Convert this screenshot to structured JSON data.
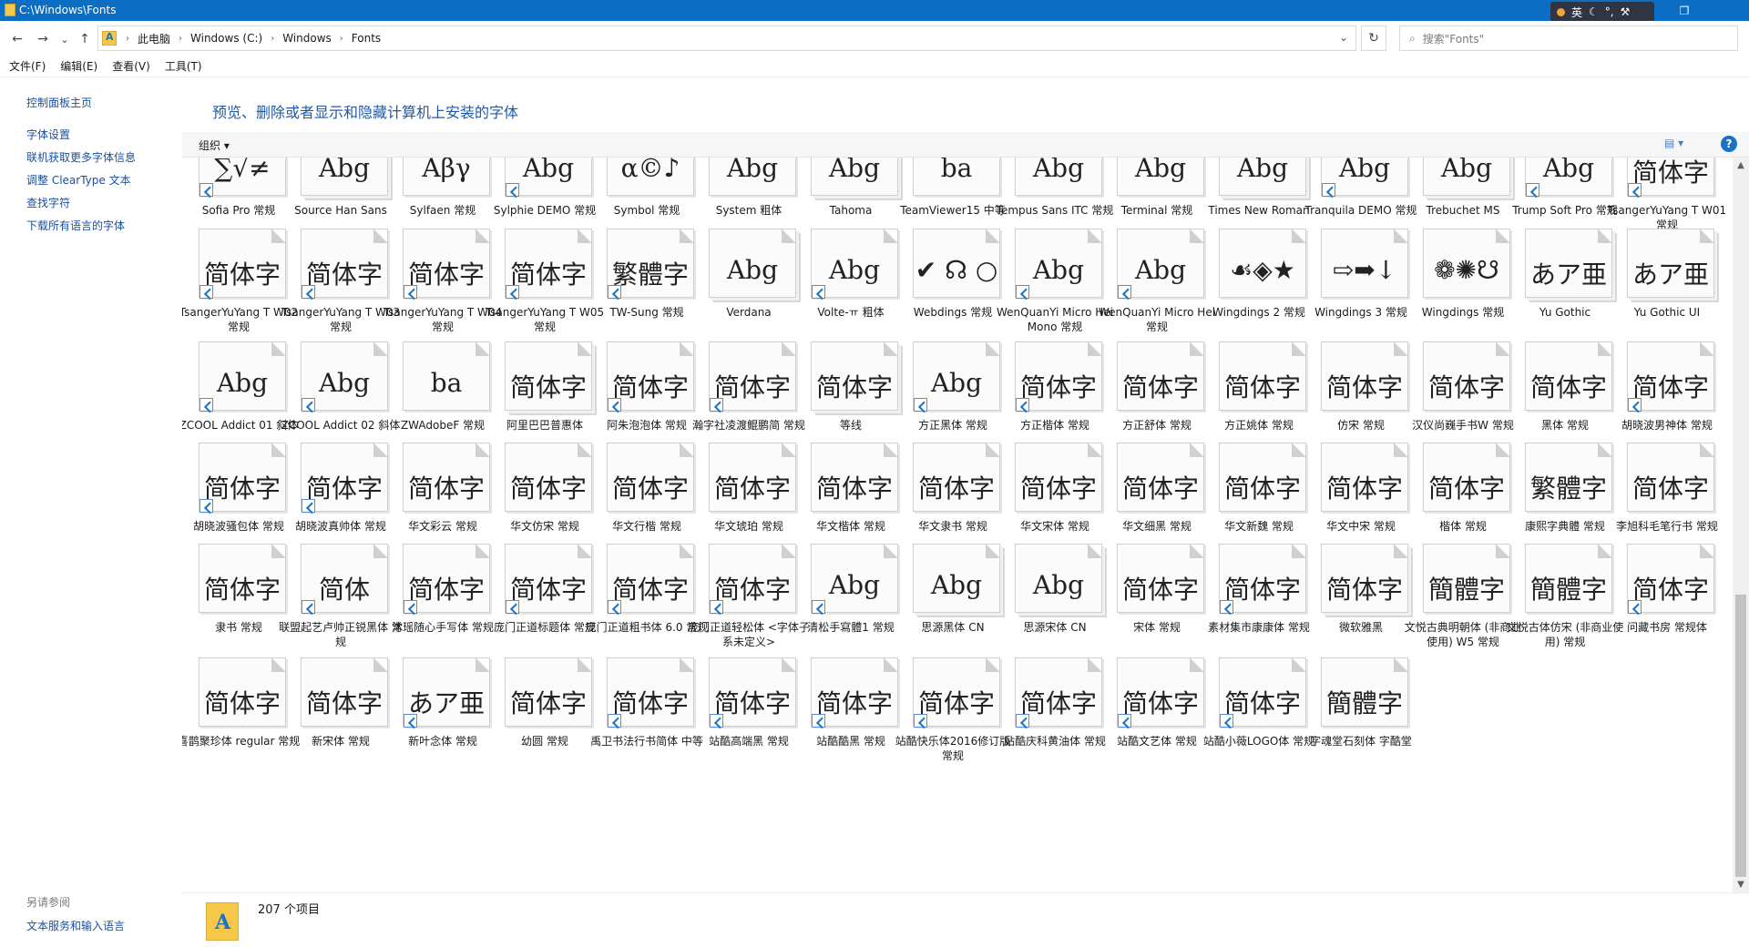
{
  "window": {
    "title": "C:\\Windows\\Fonts",
    "min": "—",
    "max": "❐",
    "close": "✕"
  },
  "ime": {
    "lang": "英",
    "moon": "☾",
    "punct": "°,",
    "tool": "⚒",
    "shirt": "▣"
  },
  "nav": {
    "back": "←",
    "forward": "→",
    "recent": "⌄",
    "up": "↑",
    "refresh": "↻",
    "dropdown": "⌄"
  },
  "breadcrumb": [
    "此电脑",
    "Windows (C:)",
    "Windows",
    "Fonts"
  ],
  "search": {
    "placeholder": "搜索\"Fonts\"",
    "icon": "⌕"
  },
  "menu": [
    "文件(F)",
    "编辑(E)",
    "查看(V)",
    "工具(T)"
  ],
  "left_links": [
    "控制面板主页",
    "字体设置",
    "联机获取更多字体信息",
    "调整 ClearType 文本",
    "查找字符",
    "下载所有语言的字体"
  ],
  "see_also": {
    "title": "另请参阅",
    "link": "文本服务和输入语言"
  },
  "header": {
    "description": "预览、删除或者显示和隐藏计算机上安装的字体"
  },
  "toolbar": {
    "organize": "组织 ▾",
    "view": "▤ ▾",
    "help": "?"
  },
  "status": {
    "count": "207 个项目"
  },
  "scroll": {
    "up": "▲",
    "down": "▼"
  },
  "rows": [
    [
      {
        "s": "∑√≠",
        "l": "Sofia Pro 常规",
        "sc": true,
        "st": false
      },
      {
        "s": "Abg",
        "l": "Source Han Sans",
        "sc": false,
        "st": true
      },
      {
        "s": "Αβγ",
        "l": "Sylfaen 常规",
        "sc": false,
        "st": false
      },
      {
        "s": "Abg",
        "l": "Sylphie DEMO 常规",
        "sc": true,
        "st": false
      },
      {
        "s": "α©♪",
        "l": "Symbol 常规",
        "sc": false,
        "st": false
      },
      {
        "s": "Abg",
        "l": "System 粗体",
        "sc": false,
        "st": false
      },
      {
        "s": "Abg",
        "l": "Tahoma",
        "sc": false,
        "st": true
      },
      {
        "s": "ba",
        "l": "TeamViewer15 中等",
        "sc": false,
        "st": false
      },
      {
        "s": "Abg",
        "l": "Tempus Sans ITC 常规",
        "sc": false,
        "st": false
      },
      {
        "s": "Abg",
        "l": "Terminal 常规",
        "sc": false,
        "st": false
      },
      {
        "s": "Abg",
        "l": "Times New Roman",
        "sc": false,
        "st": true
      },
      {
        "s": "Abg",
        "l": "Tranquila DEMO 常规",
        "sc": true,
        "st": false
      },
      {
        "s": "Abg",
        "l": "Trebuchet MS",
        "sc": false,
        "st": true
      },
      {
        "s": "Abg",
        "l": "Trump Soft Pro 常规",
        "sc": true,
        "st": false
      },
      {
        "s": "简体字",
        "l": "TsangerYuYang T W01 常规",
        "sc": true,
        "st": false
      }
    ],
    [
      {
        "s": "简体字",
        "l": "TsangerYuYang T W02 常规",
        "sc": true,
        "st": false
      },
      {
        "s": "简体字",
        "l": "TsangerYuYang T W03 常规",
        "sc": true,
        "st": false
      },
      {
        "s": "简体字",
        "l": "TsangerYuYang T W04 常规",
        "sc": true,
        "st": false
      },
      {
        "s": "简体字",
        "l": "TsangerYuYang T W05 常规",
        "sc": true,
        "st": false
      },
      {
        "s": "繁體字",
        "l": "TW-Sung 常规",
        "sc": true,
        "st": false
      },
      {
        "s": "Abg",
        "l": "Verdana",
        "sc": false,
        "st": true
      },
      {
        "s": "Abg",
        "l": "Volte-ㅠ 粗体",
        "sc": true,
        "st": false
      },
      {
        "s": "✔ ☊ ○",
        "l": "Webdings 常规",
        "sc": false,
        "st": false
      },
      {
        "s": "Abg",
        "l": "WenQuanYi Micro Hei Mono 常规",
        "sc": true,
        "st": false
      },
      {
        "s": "Abg",
        "l": "WenQuanYi Micro Hei 常规",
        "sc": true,
        "st": false
      },
      {
        "s": "☙◈★",
        "l": "Wingdings 2 常规",
        "sc": false,
        "st": false
      },
      {
        "s": "⇨➡↓",
        "l": "Wingdings 3 常规",
        "sc": false,
        "st": false
      },
      {
        "s": "❁✺☋",
        "l": "Wingdings 常规",
        "sc": false,
        "st": false
      },
      {
        "s": "あア亜",
        "l": "Yu Gothic",
        "sc": false,
        "st": true
      },
      {
        "s": "あア亜",
        "l": "Yu Gothic UI",
        "sc": false,
        "st": true
      }
    ],
    [
      {
        "s": "Abg",
        "l": "ZCOOL Addict 01 斜体",
        "sc": true,
        "st": false
      },
      {
        "s": "Abg",
        "l": "ZCOOL Addict 02 斜体",
        "sc": true,
        "st": false
      },
      {
        "s": "ba",
        "l": "ZWAdobeF 常规",
        "sc": false,
        "st": false
      },
      {
        "s": "简体字",
        "l": "阿里巴巴普惠体",
        "sc": false,
        "st": true
      },
      {
        "s": "简体字",
        "l": "阿朱泡泡体 常规",
        "sc": true,
        "st": false
      },
      {
        "s": "简体字",
        "l": "瀚字社凌渡鲲鹏简 常规",
        "sc": true,
        "st": false
      },
      {
        "s": "简体字",
        "l": "等线",
        "sc": false,
        "st": true
      },
      {
        "s": "Abg",
        "l": "方正黑体 常规",
        "sc": true,
        "st": false
      },
      {
        "s": "简体字",
        "l": "方正楷体 常规",
        "sc": true,
        "st": false
      },
      {
        "s": "简体字",
        "l": "方正舒体 常规",
        "sc": false,
        "st": false
      },
      {
        "s": "简体字",
        "l": "方正姚体 常规",
        "sc": false,
        "st": false
      },
      {
        "s": "简体字",
        "l": "仿宋 常规",
        "sc": false,
        "st": false
      },
      {
        "s": "简体字",
        "l": "汉仪尚巍手书W 常规",
        "sc": false,
        "st": false
      },
      {
        "s": "简体字",
        "l": "黑体 常规",
        "sc": false,
        "st": false
      },
      {
        "s": "简体字",
        "l": "胡晓波男神体 常规",
        "sc": true,
        "st": false
      }
    ],
    [
      {
        "s": "简体字",
        "l": "胡晓波骚包体 常规",
        "sc": true,
        "st": false
      },
      {
        "s": "简体字",
        "l": "胡晓波真帅体 常规",
        "sc": true,
        "st": false
      },
      {
        "s": "简体字",
        "l": "华文彩云 常规",
        "sc": false,
        "st": false
      },
      {
        "s": "简体字",
        "l": "华文仿宋 常规",
        "sc": false,
        "st": false
      },
      {
        "s": "简体字",
        "l": "华文行楷 常规",
        "sc": false,
        "st": false
      },
      {
        "s": "简体字",
        "l": "华文琥珀 常规",
        "sc": false,
        "st": false
      },
      {
        "s": "简体字",
        "l": "华文楷体 常规",
        "sc": false,
        "st": false
      },
      {
        "s": "简体字",
        "l": "华文隶书 常规",
        "sc": false,
        "st": false
      },
      {
        "s": "简体字",
        "l": "华文宋体 常规",
        "sc": false,
        "st": false
      },
      {
        "s": "简体字",
        "l": "华文细黑 常规",
        "sc": false,
        "st": false
      },
      {
        "s": "简体字",
        "l": "华文新魏 常规",
        "sc": false,
        "st": false
      },
      {
        "s": "简体字",
        "l": "华文中宋 常规",
        "sc": false,
        "st": false
      },
      {
        "s": "简体字",
        "l": "楷体 常规",
        "sc": false,
        "st": false
      },
      {
        "s": "繁體字",
        "l": "康熙字典體 常规",
        "sc": false,
        "st": false
      },
      {
        "s": "简体字",
        "l": "李旭科毛笔行书 常规",
        "sc": false,
        "st": false
      }
    ],
    [
      {
        "s": "简体字",
        "l": "隶书 常规",
        "sc": false,
        "st": false
      },
      {
        "s": "简体",
        "l": "联盟起艺卢帅正锐黑体 常规",
        "sc": true,
        "st": false
      },
      {
        "s": "简体字",
        "l": "沐瑶随心手写体 常规",
        "sc": true,
        "st": false
      },
      {
        "s": "简体字",
        "l": "庞门正道标题体 常规",
        "sc": true,
        "st": false
      },
      {
        "s": "简体字",
        "l": "庞门正道粗书体 6.0 常规",
        "sc": true,
        "st": false
      },
      {
        "s": "简体字",
        "l": "庞门正道轻松体 <字体子系未定义>",
        "sc": true,
        "st": false
      },
      {
        "s": "Abg",
        "l": "清松手寫體1 常规",
        "sc": true,
        "st": false
      },
      {
        "s": "Abg",
        "l": "思源黑体 CN",
        "sc": false,
        "st": true
      },
      {
        "s": "Abg",
        "l": "思源宋体 CN",
        "sc": false,
        "st": true
      },
      {
        "s": "简体字",
        "l": "宋体 常规",
        "sc": false,
        "st": false
      },
      {
        "s": "简体字",
        "l": "素材集市康康体 常规",
        "sc": true,
        "st": false
      },
      {
        "s": "简体字",
        "l": "微软雅黑",
        "sc": false,
        "st": true
      },
      {
        "s": "簡體字",
        "l": "文悦古典明朝体 (非商业使用) W5 常规",
        "sc": false,
        "st": false
      },
      {
        "s": "簡體字",
        "l": "文悦古体仿宋 (非商业使用) 常规",
        "sc": false,
        "st": false
      },
      {
        "s": "简体字",
        "l": "问藏书房 常规体",
        "sc": true,
        "st": false
      }
    ],
    [
      {
        "s": "简体字",
        "l": "喜鹊聚珍体 regular 常规",
        "sc": false,
        "st": false
      },
      {
        "s": "简体字",
        "l": "新宋体 常规",
        "sc": false,
        "st": false
      },
      {
        "s": "あア亜",
        "l": "新叶念体 常规",
        "sc": true,
        "st": false
      },
      {
        "s": "简体字",
        "l": "幼圆 常规",
        "sc": false,
        "st": false
      },
      {
        "s": "简体字",
        "l": "禹卫书法行书简体 中等",
        "sc": true,
        "st": false
      },
      {
        "s": "简体字",
        "l": "站酷高端黑 常规",
        "sc": true,
        "st": false
      },
      {
        "s": "简体字",
        "l": "站酷酷黑 常规",
        "sc": true,
        "st": false
      },
      {
        "s": "简体字",
        "l": "站酷快乐体2016修订版 常规",
        "sc": true,
        "st": false
      },
      {
        "s": "简体字",
        "l": "站酷庆科黄油体 常规",
        "sc": true,
        "st": false
      },
      {
        "s": "简体字",
        "l": "站酷文艺体 常规",
        "sc": true,
        "st": false
      },
      {
        "s": "简体字",
        "l": "站酷小薇LOGO体 常规",
        "sc": true,
        "st": false
      },
      {
        "s": "簡體字",
        "l": "字魂堂石刻体 字酷堂",
        "sc": false,
        "st": false
      }
    ]
  ]
}
